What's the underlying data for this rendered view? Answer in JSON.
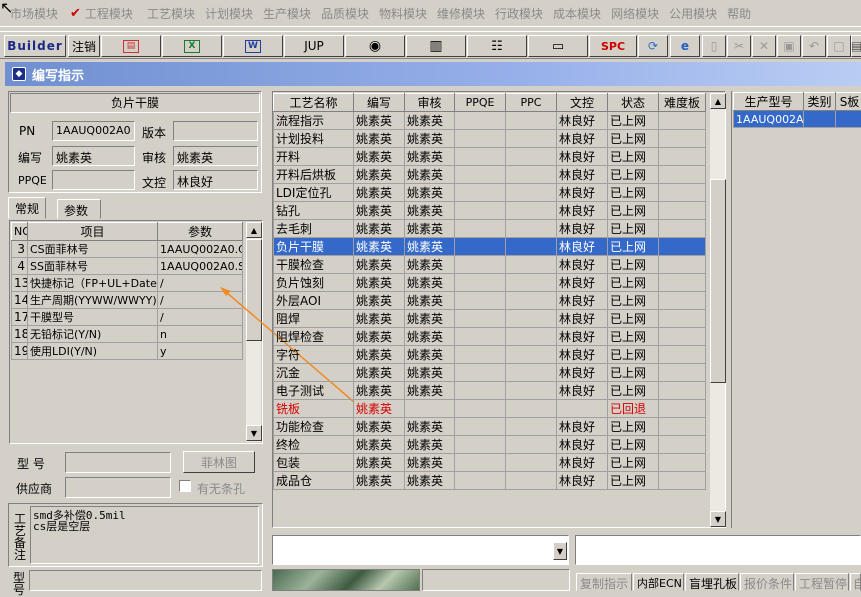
{
  "menu": [
    "市场模块",
    "工程模块",
    "工艺模块",
    "计划模块",
    "生产模块",
    "品质模块",
    "物料模块",
    "维修模块",
    "行政模块",
    "成本模块",
    "网络模块",
    "公用模块",
    "帮助"
  ],
  "toolbar": {
    "builder": "Builder",
    "logout": "注销",
    "jup": "JUP",
    "spc": "SPC"
  },
  "window_title": "编写指示",
  "product_box": {
    "title": "负片干膜",
    "pn_label": "PN",
    "pn_value": "1AAUQ002A0",
    "version_label": "版本",
    "version_value": "",
    "author_label": "编写",
    "author_value": "姚素英",
    "review_label": "审核",
    "review_value": "姚素英",
    "ppqe_label": "PPQE",
    "ppqe_value": "",
    "control_label": "文控",
    "control_value": "林良好"
  },
  "tabs": [
    "常规",
    "参数"
  ],
  "param_table": {
    "headers": [
      "NO",
      "项目",
      "参数"
    ],
    "rows": [
      [
        "3",
        "CS面菲林号",
        "1AAUQ002A0.CS"
      ],
      [
        "4",
        "SS面菲林号",
        "1AAUQ002A0.SS"
      ],
      [
        "13",
        "快捷标记（FP+UL+DateC",
        "/"
      ],
      [
        "14",
        "生产周期(YYWW/WWYY)",
        "/"
      ],
      [
        "17",
        "干膜型号",
        "/"
      ],
      [
        "18",
        "无铅标记(Y/N)",
        "n"
      ],
      [
        "19",
        "使用LDI(Y/N)",
        "y"
      ]
    ]
  },
  "model_label": "型  号",
  "film_button": "菲林图",
  "supplier_label": "供应商",
  "no_slot_label": "有无条孔",
  "remark_label": "工艺备注",
  "remark_text": "smd多补偿0.5mil\ncs层是空层",
  "model_label2": "型号",
  "process_table": {
    "headers": [
      "工艺名称",
      "编写",
      "审核",
      "PPQE",
      "PPC",
      "文控",
      "状态",
      "难度板"
    ],
    "rows": [
      [
        "流程指示",
        "姚素英",
        "姚素英",
        "",
        "",
        "林良好",
        "已上网",
        ""
      ],
      [
        "计划投料",
        "姚素英",
        "姚素英",
        "",
        "",
        "林良好",
        "已上网",
        ""
      ],
      [
        "开料",
        "姚素英",
        "姚素英",
        "",
        "",
        "林良好",
        "已上网",
        ""
      ],
      [
        "开料后烘板",
        "姚素英",
        "姚素英",
        "",
        "",
        "林良好",
        "已上网",
        ""
      ],
      [
        "LDI定位孔",
        "姚素英",
        "姚素英",
        "",
        "",
        "林良好",
        "已上网",
        ""
      ],
      [
        "钻孔",
        "姚素英",
        "姚素英",
        "",
        "",
        "林良好",
        "已上网",
        ""
      ],
      [
        "去毛刺",
        "姚素英",
        "姚素英",
        "",
        "",
        "林良好",
        "已上网",
        ""
      ],
      [
        "负片干膜",
        "姚素英",
        "姚素英",
        "",
        "",
        "林良好",
        "已上网",
        ""
      ],
      [
        "干膜检查",
        "姚素英",
        "姚素英",
        "",
        "",
        "林良好",
        "已上网",
        ""
      ],
      [
        "负片蚀刻",
        "姚素英",
        "姚素英",
        "",
        "",
        "林良好",
        "已上网",
        ""
      ],
      [
        "外层AOI",
        "姚素英",
        "姚素英",
        "",
        "",
        "林良好",
        "已上网",
        ""
      ],
      [
        "阻焊",
        "姚素英",
        "姚素英",
        "",
        "",
        "林良好",
        "已上网",
        ""
      ],
      [
        "阻焊检查",
        "姚素英",
        "姚素英",
        "",
        "",
        "林良好",
        "已上网",
        ""
      ],
      [
        "字符",
        "姚素英",
        "姚素英",
        "",
        "",
        "林良好",
        "已上网",
        ""
      ],
      [
        "沉金",
        "姚素英",
        "姚素英",
        "",
        "",
        "林良好",
        "已上网",
        ""
      ],
      [
        "电子测试",
        "姚素英",
        "姚素英",
        "",
        "",
        "林良好",
        "已上网",
        ""
      ],
      [
        "铣板",
        "姚素英",
        "",
        "",
        "",
        "",
        "已回退",
        ""
      ],
      [
        "功能检查",
        "姚素英",
        "姚素英",
        "",
        "",
        "林良好",
        "已上网",
        ""
      ],
      [
        "终检",
        "姚素英",
        "姚素英",
        "",
        "",
        "林良好",
        "已上网",
        ""
      ],
      [
        "包装",
        "姚素英",
        "姚素英",
        "",
        "",
        "林良好",
        "已上网",
        ""
      ],
      [
        "成品仓",
        "姚素英",
        "姚素英",
        "",
        "",
        "林良好",
        "已上网",
        ""
      ]
    ],
    "selected_index": 7,
    "red_index": 16
  },
  "right_table": {
    "headers": [
      "生产型号",
      "类别",
      "S板"
    ],
    "rows": [
      [
        "1AAUQ002A0",
        "",
        ""
      ]
    ]
  },
  "bottom_tabs": [
    "复制指示",
    "内部ECN",
    "盲埋孔板",
    "报价条件",
    "工程暂停",
    "自"
  ]
}
